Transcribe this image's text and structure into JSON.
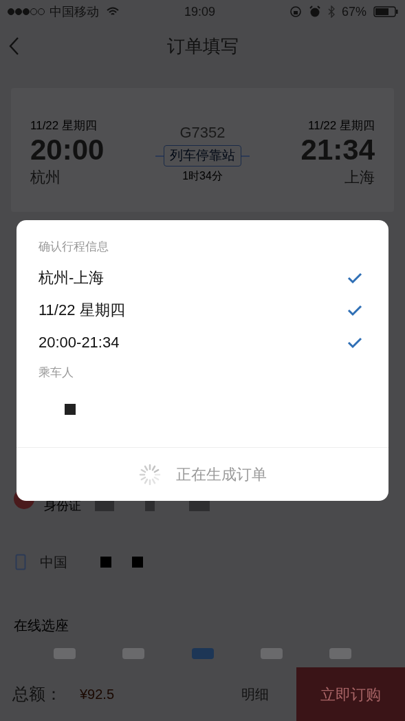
{
  "status_bar": {
    "carrier": "中国移动",
    "time": "19:09",
    "battery": "67%"
  },
  "nav": {
    "title": "订单填写"
  },
  "trip": {
    "depart": {
      "date": "11/22 星期四",
      "time": "20:00",
      "station": "杭州"
    },
    "arrive": {
      "date": "11/22 星期四",
      "time": "21:34",
      "station": "上海"
    },
    "train": "G7352",
    "stops_button": "列车停靠站",
    "duration": "1时34分"
  },
  "passenger": {
    "id_type": "身份证"
  },
  "contact": {
    "country": "中国"
  },
  "seat_section": {
    "title": "在线选座"
  },
  "footer": {
    "total_label": "总额：",
    "total": "¥92.5",
    "detail": "明细",
    "submit": "立即订购"
  },
  "dialog": {
    "title": "确认行程信息",
    "items": [
      {
        "text": "杭州-上海",
        "checked": true
      },
      {
        "text": "11/22 星期四",
        "checked": true
      },
      {
        "text": "20:00-21:34",
        "checked": true
      }
    ],
    "passenger_label": "乘车人",
    "status": "正在生成订单"
  }
}
